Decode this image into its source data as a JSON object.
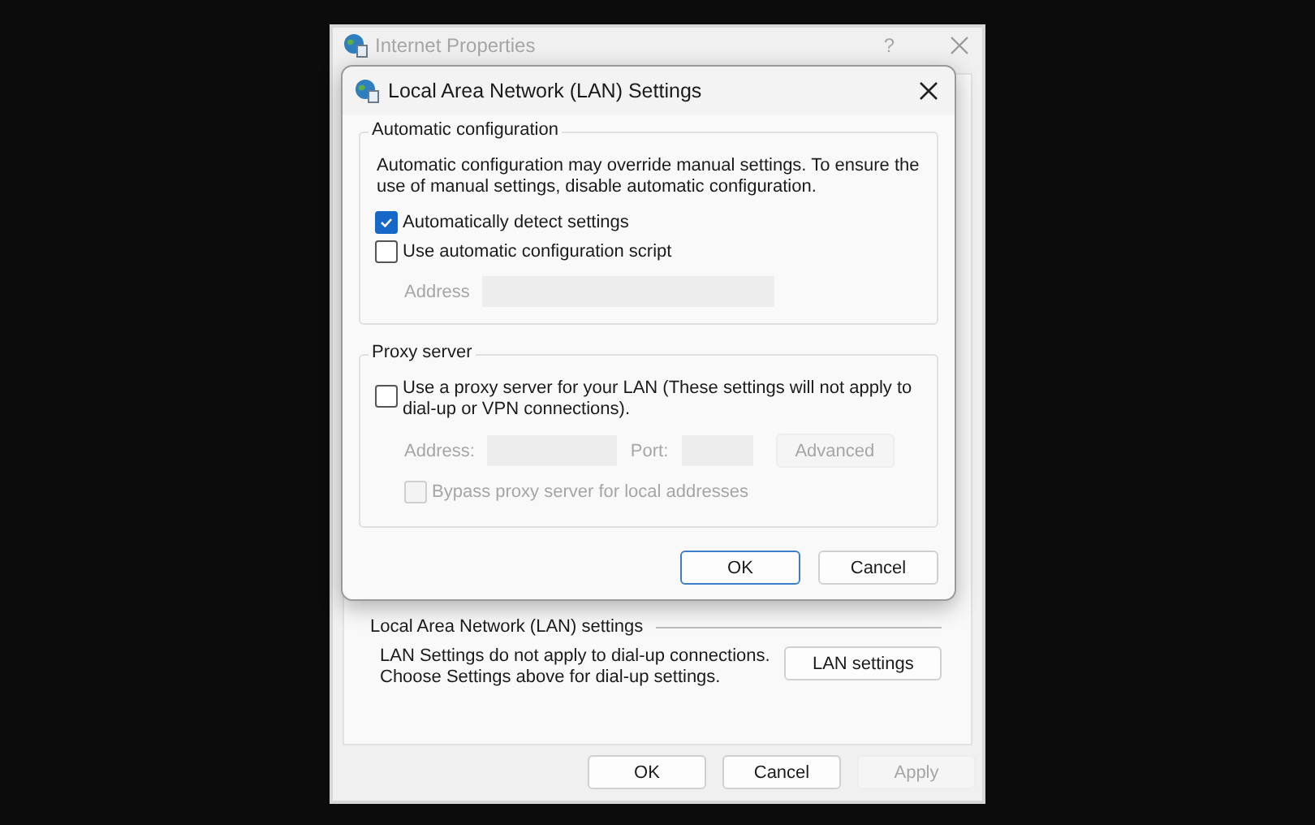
{
  "parent_window": {
    "title": "Internet Properties",
    "help": "?",
    "lan_section": {
      "heading": "Local Area Network (LAN) settings",
      "text": "LAN Settings do not apply to dial-up connections. Choose Settings above for dial-up settings.",
      "button": "LAN settings"
    },
    "buttons": [
      {
        "label": "OK",
        "disabled": false
      },
      {
        "label": "Cancel",
        "disabled": false
      },
      {
        "label": "Apply",
        "disabled": true
      }
    ]
  },
  "dialog": {
    "title": "Local Area Network (LAN) Settings",
    "automatic_configuration": {
      "legend": "Automatic configuration",
      "description": "Automatic configuration may override manual settings.  To ensure the use of manual settings, disable automatic configuration.",
      "checkboxes": [
        {
          "label": "Automatically detect settings",
          "checked": true,
          "disabled": false
        },
        {
          "label": "Use automatic configuration script",
          "checked": false,
          "disabled": false
        }
      ],
      "address": {
        "label": "Address",
        "disabled": true
      }
    },
    "proxy_server": {
      "legend": "Proxy server",
      "use_proxy": {
        "label": "Use a proxy server for your LAN (These settings will not apply to dial-up or VPN connections).",
        "checked": false,
        "disabled": false
      },
      "address_label": "Address:",
      "port_label": "Port:",
      "advanced": {
        "label": "Advanced",
        "disabled": true
      },
      "bypass": {
        "label": "Bypass proxy server for local addresses",
        "checked": false,
        "disabled": true
      }
    },
    "buttons": [
      {
        "label": "OK",
        "selected": true
      },
      {
        "label": "Cancel",
        "selected": false
      }
    ]
  }
}
